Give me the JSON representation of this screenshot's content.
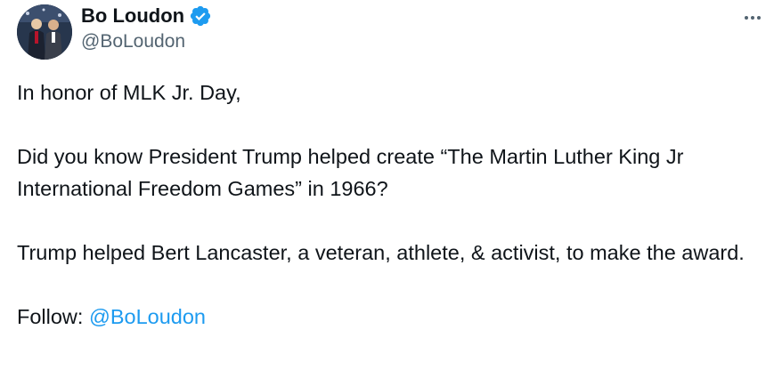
{
  "author": {
    "display_name": "Bo Loudon",
    "handle": "@BoLoudon",
    "verified": true,
    "verified_color": "#1d9bf0"
  },
  "menu": {
    "icon": "more-horizontal-icon"
  },
  "tweet": {
    "line1": "In honor of MLK Jr. Day,",
    "line2": "Did you know President Trump helped create “The Martin Luther King Jr International Freedom Games” in 1966?",
    "line3": "Trump helped Bert Lancaster, a veteran, athlete, & activist, to make the award.",
    "follow_label": "Follow: ",
    "follow_mention": "@BoLoudon"
  },
  "colors": {
    "text": "#0f1419",
    "secondary": "#536471",
    "link": "#1d9bf0"
  }
}
